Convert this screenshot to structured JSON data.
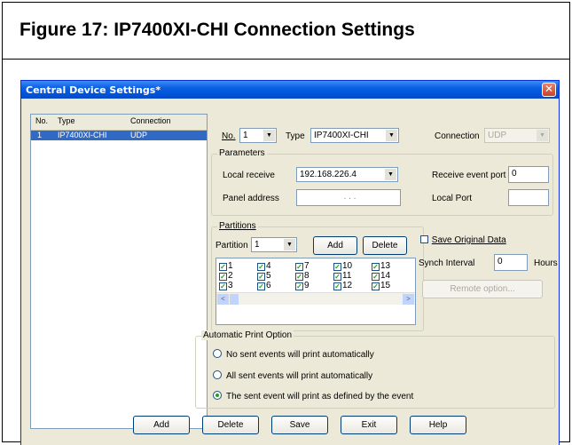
{
  "figure": {
    "title": "Figure 17:  IP7400XI-CHI Connection Settings"
  },
  "window": {
    "title": "Central Device Settings*",
    "close_glyph": "✕"
  },
  "device_list": {
    "columns": [
      "No.",
      "Type",
      "Connection"
    ],
    "rows": [
      {
        "no": "1",
        "type": "IP7400XI-CHI",
        "connection": "UDP"
      }
    ]
  },
  "top": {
    "no_label": "No.",
    "no_value": "1",
    "type_label": "Type",
    "type_value": "IP7400XI-CHI",
    "connection_label": "Connection",
    "connection_value": "UDP"
  },
  "parameters": {
    "title": "Parameters",
    "local_receive_label": "Local receive",
    "local_receive_value": "192.168.226.4",
    "panel_address_label": "Panel address",
    "panel_address_value": ".        .        .",
    "receive_event_port_label": "Receive event port",
    "receive_event_port_value": "0",
    "local_port_label": "Local Port",
    "local_port_value": ""
  },
  "partitions": {
    "title": "Partitions",
    "partition_label": "Partition",
    "partition_value": "1",
    "add_label": "Add",
    "delete_label": "Delete",
    "items": [
      "1",
      "2",
      "3",
      "4",
      "5",
      "6",
      "7",
      "8",
      "9",
      "10",
      "11",
      "12",
      "13",
      "14",
      "15"
    ]
  },
  "sync": {
    "save_original_label": "Save Original Data",
    "synch_interval_label": "Synch Interval",
    "synch_interval_value": "0",
    "hours_label": "Hours",
    "remote_option_label": "Remote option..."
  },
  "print_option": {
    "title": "Automatic Print Option",
    "options": [
      "No sent events will print automatically",
      "All sent events will print automatically",
      "The sent event will print as defined by the event"
    ],
    "selected_index": 2
  },
  "footer": {
    "add": "Add",
    "delete": "Delete",
    "save": "Save",
    "exit": "Exit",
    "help": "Help"
  },
  "icons": {
    "dropdown": "▼",
    "check": "✓",
    "scroll_left": "<",
    "scroll_right": ">"
  },
  "colors": {
    "titlebar": "#0052d6",
    "selection": "#316ac5",
    "dialog_bg": "#ece9d8"
  }
}
